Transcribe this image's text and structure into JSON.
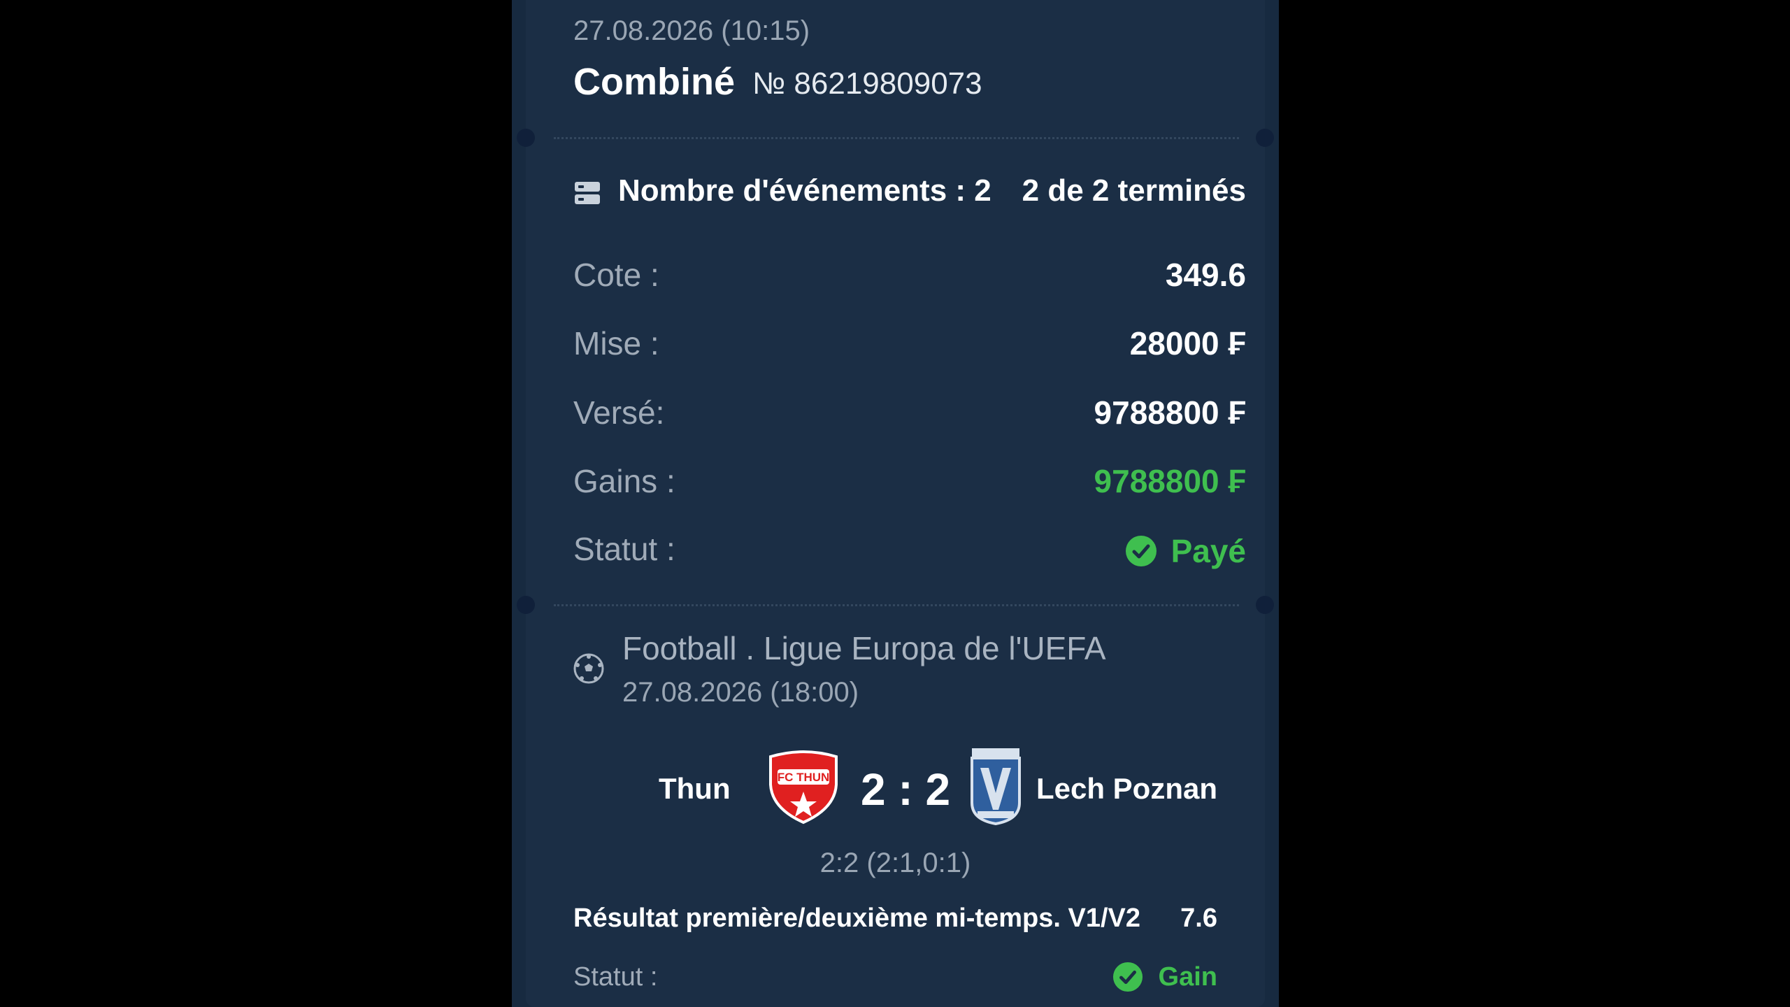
{
  "bet": {
    "date": "27.08.2026 (10:15)",
    "type": "Combiné",
    "number": "№ 86219809073"
  },
  "events": {
    "label": "Nombre d'événements : 2",
    "done": "2 de 2 terminés"
  },
  "summary": {
    "odds_label": "Cote :",
    "odds_value": "349.6",
    "stake_label": "Mise :",
    "stake_value": "28000 ₣",
    "paid_label": "Versé:",
    "paid_value": "9788800 ₣",
    "winnings_label": "Gains :",
    "winnings_value": "9788800 ₣",
    "status_label": "Statut :",
    "status_value": "Payé"
  },
  "match": {
    "league": "Football . Ligue Europa de l'UEFA",
    "date": "27.08.2026 (18:00)",
    "home_team": "Thun",
    "away_team": "Lech Poznan",
    "score": "2 : 2",
    "score_detail": "2:2 (2:1,0:1)",
    "home_logo": "FC THUN",
    "market": "Résultat première/deuxième mi-temps. V1/V2",
    "odd": "7.6",
    "status_label": "Statut :",
    "status_value": "Gain"
  },
  "colors": {
    "background": "#000000",
    "card": "#1b2e45",
    "win_green": "#3fbf4f",
    "muted_text": "#9aa6b4"
  },
  "icons": {
    "events": "list-icon",
    "status": "check-circle-icon",
    "sport": "soccer-ball-icon"
  }
}
